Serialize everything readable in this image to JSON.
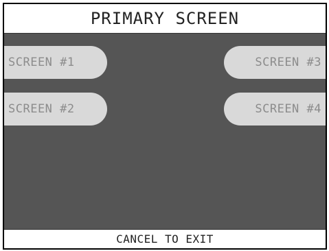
{
  "header": {
    "title": "PRIMARY SCREEN"
  },
  "buttons": {
    "left": [
      {
        "label": "SCREEN #1"
      },
      {
        "label": "SCREEN #2"
      }
    ],
    "right": [
      {
        "label": "SCREEN #3"
      },
      {
        "label": "SCREEN #4"
      }
    ]
  },
  "footer": {
    "text": "CANCEL TO EXIT"
  },
  "colors": {
    "main_background": "#555555",
    "button_fill": "#d9d9d9",
    "button_text": "#8c8c8c",
    "bar_background": "#ffffff"
  }
}
